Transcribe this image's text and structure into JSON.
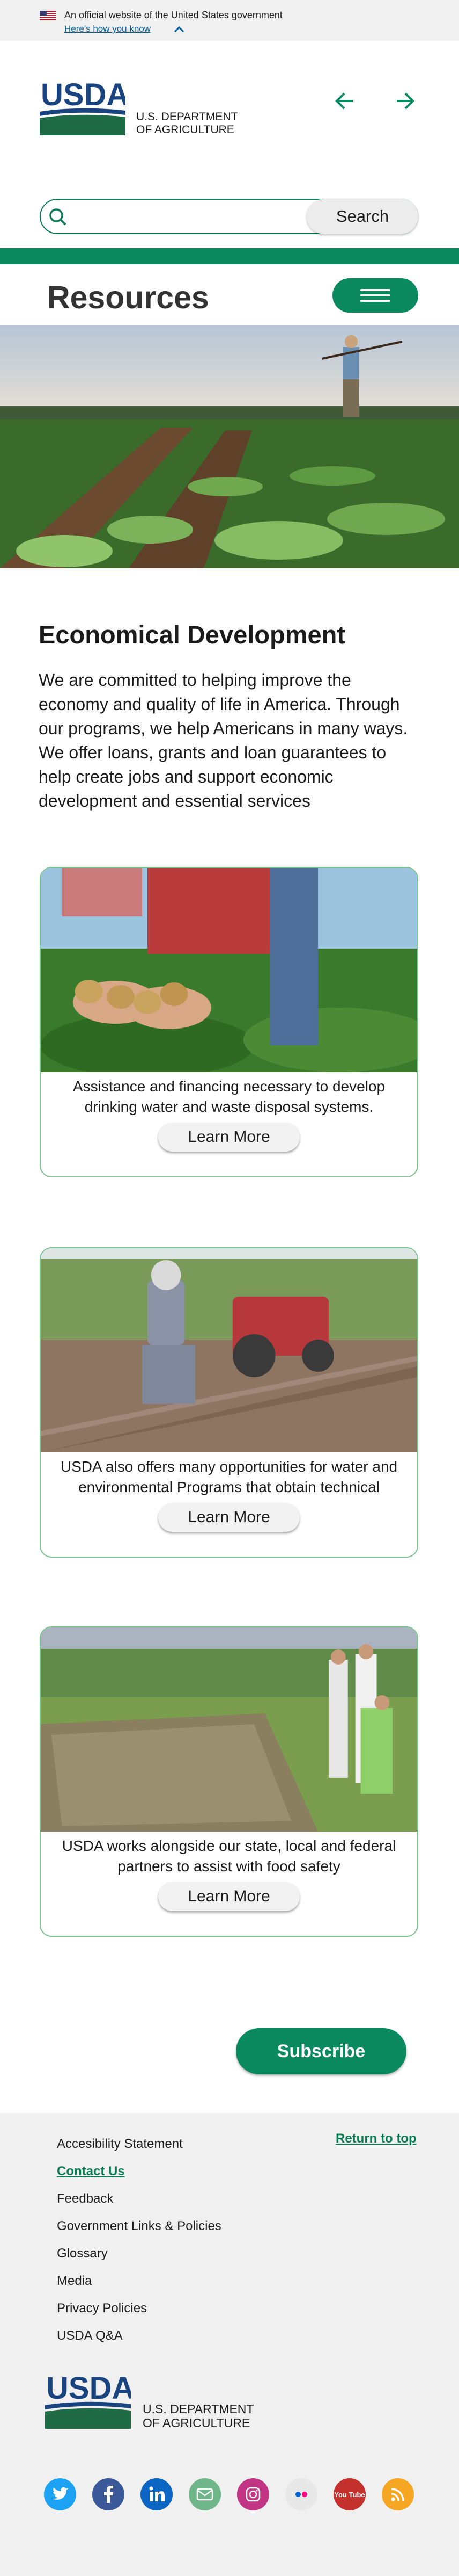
{
  "gov_banner": {
    "official_text": "An official website of the United States government",
    "how_know_text": "Here's how you know"
  },
  "header": {
    "agency_line1": "U.S. DEPARTMENT",
    "agency_line2": "OF AGRICULTURE",
    "logo_text": "USDA"
  },
  "search": {
    "button_label": "Search",
    "placeholder": ""
  },
  "nav": {
    "page_title": "Resources"
  },
  "intro": {
    "heading": "Economical Development",
    "body": "We are committed to helping improve the economy and quality of life in America. Through our programs, we help Americans in many ways. We offer loans, grants and loan guarantees to help create jobs and support economic development and essential services"
  },
  "cards": [
    {
      "text": "Assistance and financing necessary to develop drinking water and waste disposal systems.",
      "button": "Learn More"
    },
    {
      "text": "USDA also offers many opportunities for water and environmental Programs that obtain technical",
      "button": "Learn More"
    },
    {
      "text": "USDA works alongside our state, local and federal partners to assist with food safety",
      "button": "Learn More"
    }
  ],
  "subscribe_label": "Subscribe",
  "footer": {
    "links": [
      "Accesibility Statement",
      "Contact Us",
      "Feedback",
      "Government Links & Policies",
      "Glossary",
      "Media",
      "Privacy Policies",
      "USDA Q&A"
    ],
    "return_to_top": "Return to top",
    "agency_line1": "U.S. DEPARTMENT",
    "agency_line2": "OF AGRICULTURE",
    "logo_text": "USDA",
    "social_labels": [
      "You Tube"
    ]
  },
  "icons": [
    "us-flag-icon",
    "chevron-up-icon",
    "arrow-left-icon",
    "arrow-right-icon",
    "search-icon",
    "hamburger-menu-icon",
    "twitter-icon",
    "facebook-icon",
    "linkedin-icon",
    "email-icon",
    "instagram-icon",
    "flickr-icon",
    "youtube-icon",
    "rss-icon"
  ],
  "colors": {
    "primary_green": "#0b8a5f",
    "usda_blue": "#1a4480",
    "link_blue": "#005ea2",
    "card_border": "#7cc38f",
    "footer_bg": "#f0f0f0"
  }
}
